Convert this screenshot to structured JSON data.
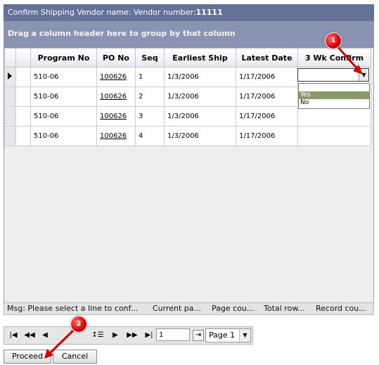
{
  "title": {
    "text": "Confirm Shipping  Vendor name:  Vendor number:",
    "vendor_number": "11111"
  },
  "group_panel": "Drag a column header here to group by that column",
  "grid": {
    "columns": [
      "Program No",
      "PO No",
      "Seq",
      "Earliest Ship",
      "Latest Date",
      "3 Wk Confirm"
    ],
    "rows": [
      {
        "program_no": "510-06",
        "po_no": "100626",
        "seq": "1",
        "earliest_ship": "1/3/2006",
        "latest_date": "1/17/2006",
        "confirm": ""
      },
      {
        "program_no": "510-06",
        "po_no": "100626",
        "seq": "2",
        "earliest_ship": "1/3/2006",
        "latest_date": "1/17/2006",
        "confirm": ""
      },
      {
        "program_no": "510-06",
        "po_no": "100626",
        "seq": "3",
        "earliest_ship": "1/3/2006",
        "latest_date": "1/17/2006",
        "confirm": ""
      },
      {
        "program_no": "510-06",
        "po_no": "100626",
        "seq": "4",
        "earliest_ship": "1/3/2006",
        "latest_date": "1/17/2006",
        "confirm": ""
      }
    ],
    "confirm_options": [
      "",
      "Yes",
      "No"
    ],
    "highlighted_option": "Yes"
  },
  "status_bar": {
    "msg": "Msg: Please select a line to conf...",
    "current_page": "Current pa...",
    "page_count": "Page cou...",
    "total_rows": "Total row...",
    "record_count": "Record cou..."
  },
  "pager": {
    "page_input": "1",
    "page_select": "Page 1"
  },
  "buttons": {
    "proceed": "Proceed",
    "cancel": "Cancel"
  },
  "callouts": [
    "1",
    "2"
  ],
  "colors": {
    "title_bg": "#64729a",
    "group_bg": "#8b93b3",
    "highlight": "#8a9a6a",
    "callout": "#d40000"
  }
}
